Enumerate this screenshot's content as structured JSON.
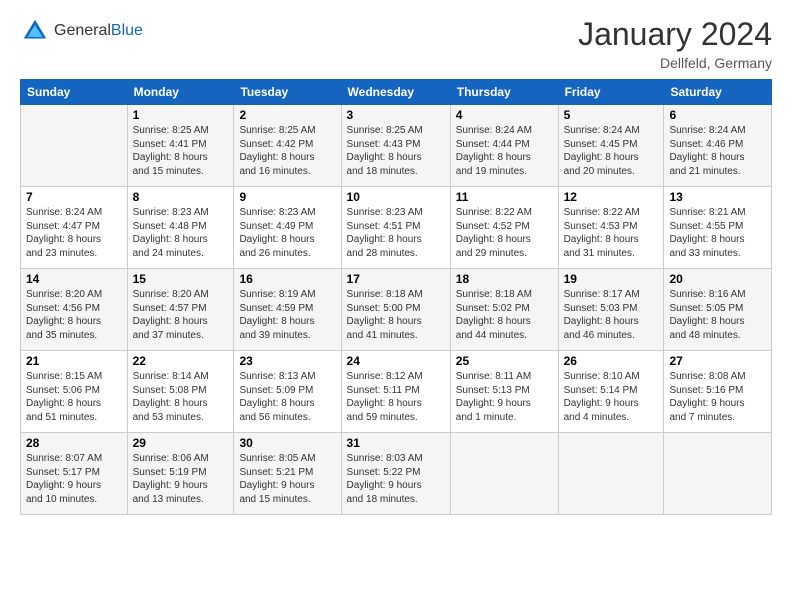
{
  "logo": {
    "general": "General",
    "blue": "Blue"
  },
  "header": {
    "title": "January 2024",
    "location": "Dellfeld, Germany"
  },
  "weekdays": [
    "Sunday",
    "Monday",
    "Tuesday",
    "Wednesday",
    "Thursday",
    "Friday",
    "Saturday"
  ],
  "weeks": [
    [
      {
        "day": "",
        "info": ""
      },
      {
        "day": "1",
        "info": "Sunrise: 8:25 AM\nSunset: 4:41 PM\nDaylight: 8 hours\nand 15 minutes."
      },
      {
        "day": "2",
        "info": "Sunrise: 8:25 AM\nSunset: 4:42 PM\nDaylight: 8 hours\nand 16 minutes."
      },
      {
        "day": "3",
        "info": "Sunrise: 8:25 AM\nSunset: 4:43 PM\nDaylight: 8 hours\nand 18 minutes."
      },
      {
        "day": "4",
        "info": "Sunrise: 8:24 AM\nSunset: 4:44 PM\nDaylight: 8 hours\nand 19 minutes."
      },
      {
        "day": "5",
        "info": "Sunrise: 8:24 AM\nSunset: 4:45 PM\nDaylight: 8 hours\nand 20 minutes."
      },
      {
        "day": "6",
        "info": "Sunrise: 8:24 AM\nSunset: 4:46 PM\nDaylight: 8 hours\nand 21 minutes."
      }
    ],
    [
      {
        "day": "7",
        "info": "Sunrise: 8:24 AM\nSunset: 4:47 PM\nDaylight: 8 hours\nand 23 minutes."
      },
      {
        "day": "8",
        "info": "Sunrise: 8:23 AM\nSunset: 4:48 PM\nDaylight: 8 hours\nand 24 minutes."
      },
      {
        "day": "9",
        "info": "Sunrise: 8:23 AM\nSunset: 4:49 PM\nDaylight: 8 hours\nand 26 minutes."
      },
      {
        "day": "10",
        "info": "Sunrise: 8:23 AM\nSunset: 4:51 PM\nDaylight: 8 hours\nand 28 minutes."
      },
      {
        "day": "11",
        "info": "Sunrise: 8:22 AM\nSunset: 4:52 PM\nDaylight: 8 hours\nand 29 minutes."
      },
      {
        "day": "12",
        "info": "Sunrise: 8:22 AM\nSunset: 4:53 PM\nDaylight: 8 hours\nand 31 minutes."
      },
      {
        "day": "13",
        "info": "Sunrise: 8:21 AM\nSunset: 4:55 PM\nDaylight: 8 hours\nand 33 minutes."
      }
    ],
    [
      {
        "day": "14",
        "info": "Sunrise: 8:20 AM\nSunset: 4:56 PM\nDaylight: 8 hours\nand 35 minutes."
      },
      {
        "day": "15",
        "info": "Sunrise: 8:20 AM\nSunset: 4:57 PM\nDaylight: 8 hours\nand 37 minutes."
      },
      {
        "day": "16",
        "info": "Sunrise: 8:19 AM\nSunset: 4:59 PM\nDaylight: 8 hours\nand 39 minutes."
      },
      {
        "day": "17",
        "info": "Sunrise: 8:18 AM\nSunset: 5:00 PM\nDaylight: 8 hours\nand 41 minutes."
      },
      {
        "day": "18",
        "info": "Sunrise: 8:18 AM\nSunset: 5:02 PM\nDaylight: 8 hours\nand 44 minutes."
      },
      {
        "day": "19",
        "info": "Sunrise: 8:17 AM\nSunset: 5:03 PM\nDaylight: 8 hours\nand 46 minutes."
      },
      {
        "day": "20",
        "info": "Sunrise: 8:16 AM\nSunset: 5:05 PM\nDaylight: 8 hours\nand 48 minutes."
      }
    ],
    [
      {
        "day": "21",
        "info": "Sunrise: 8:15 AM\nSunset: 5:06 PM\nDaylight: 8 hours\nand 51 minutes."
      },
      {
        "day": "22",
        "info": "Sunrise: 8:14 AM\nSunset: 5:08 PM\nDaylight: 8 hours\nand 53 minutes."
      },
      {
        "day": "23",
        "info": "Sunrise: 8:13 AM\nSunset: 5:09 PM\nDaylight: 8 hours\nand 56 minutes."
      },
      {
        "day": "24",
        "info": "Sunrise: 8:12 AM\nSunset: 5:11 PM\nDaylight: 8 hours\nand 59 minutes."
      },
      {
        "day": "25",
        "info": "Sunrise: 8:11 AM\nSunset: 5:13 PM\nDaylight: 9 hours\nand 1 minute."
      },
      {
        "day": "26",
        "info": "Sunrise: 8:10 AM\nSunset: 5:14 PM\nDaylight: 9 hours\nand 4 minutes."
      },
      {
        "day": "27",
        "info": "Sunrise: 8:08 AM\nSunset: 5:16 PM\nDaylight: 9 hours\nand 7 minutes."
      }
    ],
    [
      {
        "day": "28",
        "info": "Sunrise: 8:07 AM\nSunset: 5:17 PM\nDaylight: 9 hours\nand 10 minutes."
      },
      {
        "day": "29",
        "info": "Sunrise: 8:06 AM\nSunset: 5:19 PM\nDaylight: 9 hours\nand 13 minutes."
      },
      {
        "day": "30",
        "info": "Sunrise: 8:05 AM\nSunset: 5:21 PM\nDaylight: 9 hours\nand 15 minutes."
      },
      {
        "day": "31",
        "info": "Sunrise: 8:03 AM\nSunset: 5:22 PM\nDaylight: 9 hours\nand 18 minutes."
      },
      {
        "day": "",
        "info": ""
      },
      {
        "day": "",
        "info": ""
      },
      {
        "day": "",
        "info": ""
      }
    ]
  ]
}
